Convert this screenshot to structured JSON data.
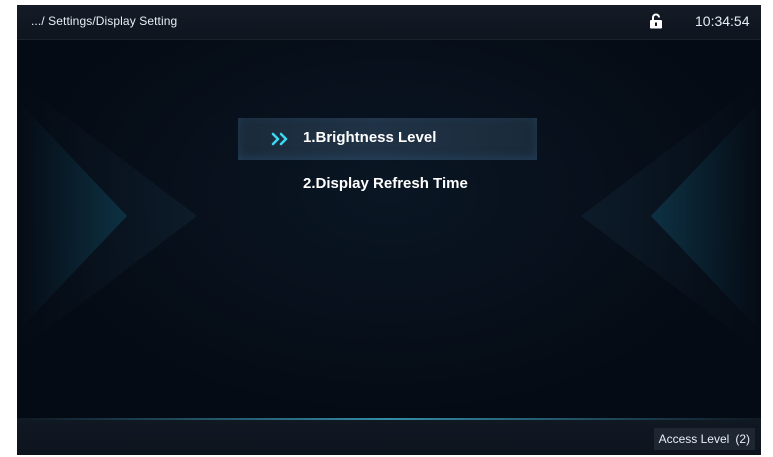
{
  "header": {
    "breadcrumb": ".../ Settings/Display Setting",
    "lock_icon": "unlocked-padlock-icon",
    "time": "10:34:54"
  },
  "menu": {
    "items": [
      {
        "label": "1.Brightness Level",
        "selected": true
      },
      {
        "label": "2.Display Refresh Time",
        "selected": false
      }
    ],
    "selected_icon": "double-chevron-right-icon"
  },
  "footer": {
    "access_label": "Access Level",
    "access_value": "(2)"
  },
  "colors": {
    "background": "#050b14",
    "accent": "#3ed6f0",
    "selected_row": "#203346"
  }
}
